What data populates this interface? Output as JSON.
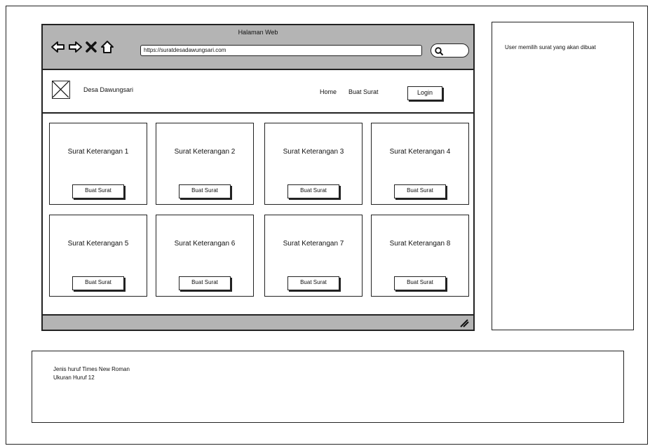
{
  "browser": {
    "title": "Halaman Web",
    "url": "https://suratdesadawungsari.com",
    "icons": [
      "back-arrow-icon",
      "forward-arrow-icon",
      "close-icon",
      "home-icon",
      "search-icon"
    ]
  },
  "header": {
    "site_name": "Desa Dawungsari",
    "nav": {
      "home": "Home",
      "buat_surat": "Buat Surat",
      "login": "Login"
    }
  },
  "cards": [
    {
      "title": "Surat Keterangan 1",
      "button": "Buat Surat"
    },
    {
      "title": "Surat Keterangan 2",
      "button": "Buat Surat"
    },
    {
      "title": "Surat Keterangan 3",
      "button": "Buat Surat"
    },
    {
      "title": "Surat Keterangan 4",
      "button": "Buat Surat"
    },
    {
      "title": "Surat Keterangan 5",
      "button": "Buat Surat"
    },
    {
      "title": "Surat Keterangan 6",
      "button": "Buat Surat"
    },
    {
      "title": "Surat Keterangan 7",
      "button": "Buat Surat"
    },
    {
      "title": "Surat Keterangan 8",
      "button": "Buat Surat"
    }
  ],
  "side_note": {
    "text": "User memilih surat yang akan dibuat"
  },
  "bottom_note": {
    "line1": "Jenis huruf Times New Roman",
    "line2": "Ukuran Huruf 12"
  }
}
